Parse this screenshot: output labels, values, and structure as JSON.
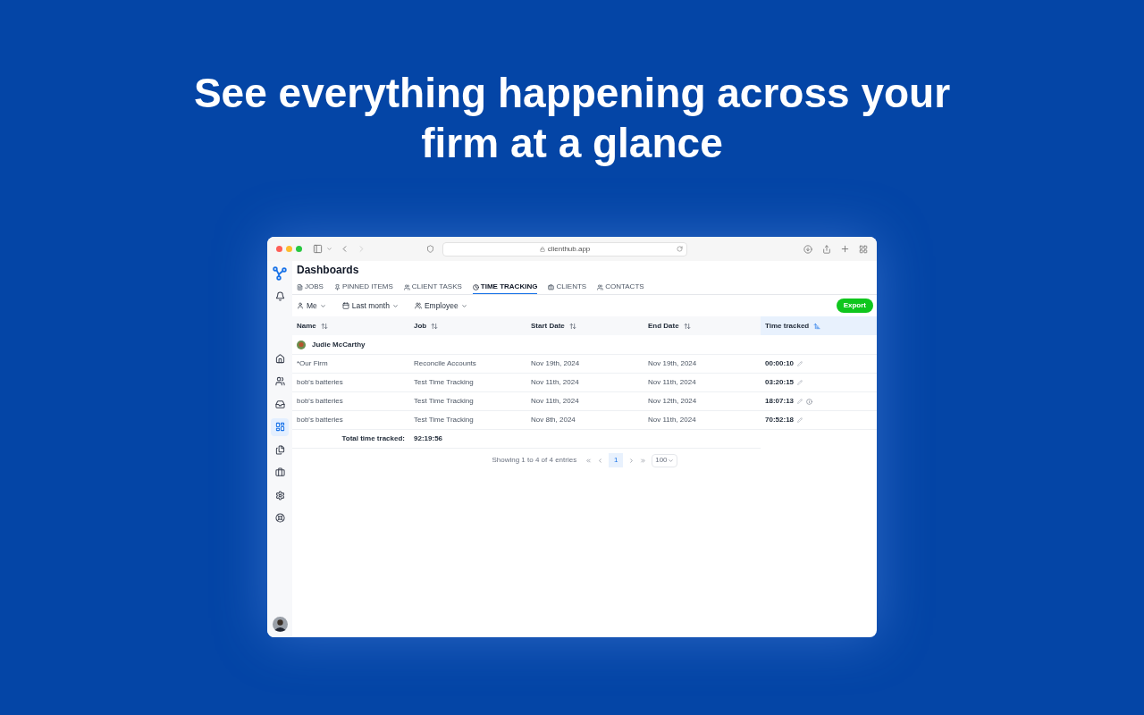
{
  "headline": "See everything happening across your firm at a glance",
  "browser": {
    "url": "clienthub.app"
  },
  "sidebar": {
    "top": [
      {
        "kind": "notifications",
        "selected": false
      }
    ],
    "items": [
      {
        "kind": "home",
        "selected": false
      },
      {
        "kind": "people",
        "selected": false
      },
      {
        "kind": "inbox",
        "selected": false
      },
      {
        "kind": "dashboard",
        "selected": true
      },
      {
        "kind": "documents",
        "selected": false
      },
      {
        "kind": "briefcase",
        "selected": false
      },
      {
        "kind": "settings",
        "selected": false
      },
      {
        "kind": "support",
        "selected": false
      }
    ]
  },
  "page": {
    "title": "Dashboards",
    "tabs": [
      {
        "label": "JOBS",
        "kind": "file",
        "selected": false
      },
      {
        "label": "PINNED ITEMS",
        "kind": "pin",
        "selected": false
      },
      {
        "label": "CLIENT TASKS",
        "kind": "people",
        "selected": false
      },
      {
        "label": "TIME TRACKING",
        "kind": "clock",
        "selected": true
      },
      {
        "label": "CLIENTS",
        "kind": "briefcase",
        "selected": false
      },
      {
        "label": "CONTACTS",
        "kind": "people",
        "selected": false
      }
    ],
    "filters": [
      {
        "label": "Me",
        "kind": "user"
      },
      {
        "label": "Last month",
        "kind": "calendar"
      },
      {
        "label": "Employee",
        "kind": "users"
      }
    ],
    "export_button": "Export",
    "table": {
      "columns": [
        {
          "label": "Name",
          "sorted": false
        },
        {
          "label": "Job",
          "sorted": false
        },
        {
          "label": "Start Date",
          "sorted": false
        },
        {
          "label": "End Date",
          "sorted": false
        },
        {
          "label": "Time tracked",
          "sorted": true
        }
      ],
      "group": {
        "name": "Judie McCarthy"
      },
      "rows": [
        {
          "name": "*Our Firm",
          "job": "Reconcile Accounts",
          "start": "Nov 19th, 2024",
          "end": "Nov 19th, 2024",
          "time": "00:00:10",
          "info": false
        },
        {
          "name": "bob's batteries",
          "job": "Test Time Tracking",
          "start": "Nov 11th, 2024",
          "end": "Nov 11th, 2024",
          "time": "03:20:15",
          "info": false
        },
        {
          "name": "bob's batteries",
          "job": "Test Time Tracking",
          "start": "Nov 11th, 2024",
          "end": "Nov 12th, 2024",
          "time": "18:07:13",
          "info": true
        },
        {
          "name": "bob's batteries",
          "job": "Test Time Tracking",
          "start": "Nov 8th, 2024",
          "end": "Nov 11th, 2024",
          "time": "70:52:18",
          "info": false
        }
      ],
      "total": {
        "label": "Total time tracked:",
        "value": "92:19:56"
      }
    },
    "pagination": {
      "summary": "Showing 1 to 4 of 4 entries",
      "pages": [
        {
          "label": "1",
          "selected": true
        }
      ],
      "page_size": "100"
    }
  }
}
